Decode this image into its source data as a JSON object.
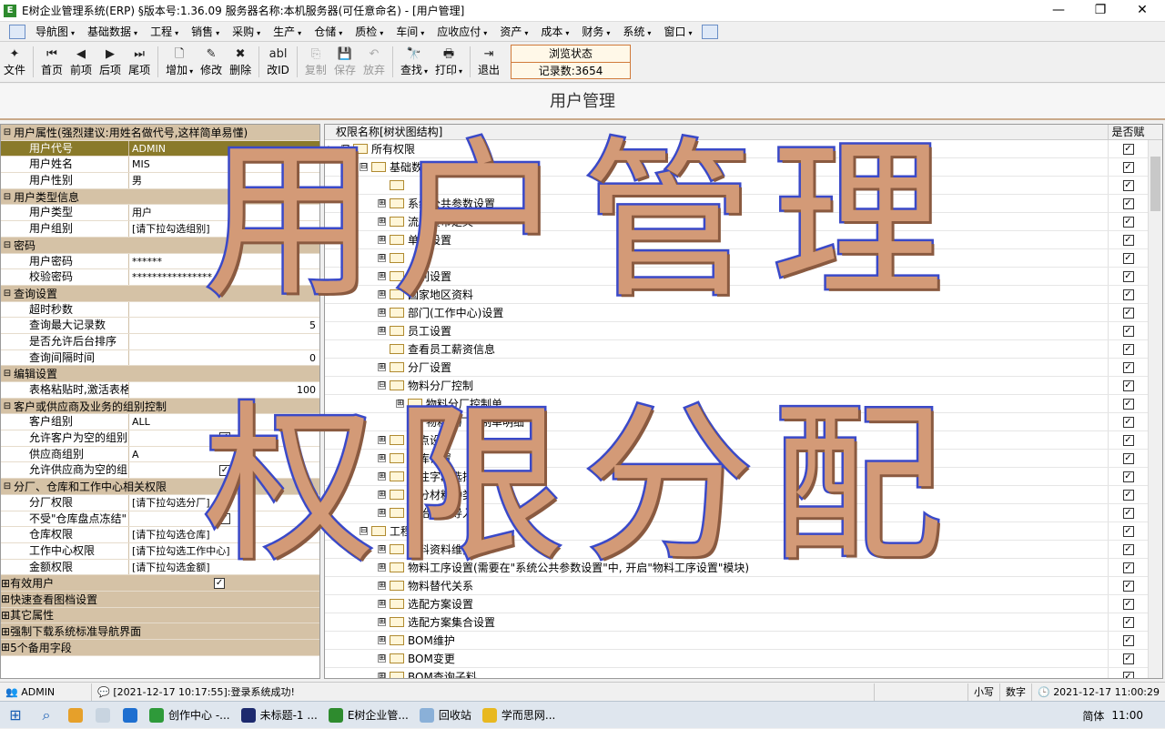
{
  "titlebar": {
    "app_icon_glyph": "E",
    "title": "E树企业管理系统(ERP) §版本号:1.36.09  服务器名称:本机服务器(可任意命名) - [用户管理]"
  },
  "menu": [
    "导航图",
    "基础数据",
    "工程",
    "销售",
    "采购",
    "生产",
    "仓储",
    "质检",
    "车间",
    "应收应付",
    "资产",
    "成本",
    "财务",
    "系统",
    "窗口"
  ],
  "toolbar": {
    "items": [
      {
        "label": "文件",
        "icon": "file-icon",
        "glyph": "✦",
        "disabled": false,
        "dropdown": false
      },
      {
        "label": "首页",
        "icon": "first-record-icon",
        "glyph": "⏮",
        "disabled": false,
        "dropdown": false
      },
      {
        "label": "前项",
        "icon": "prev-record-icon",
        "glyph": "◀",
        "disabled": false,
        "dropdown": false
      },
      {
        "label": "后项",
        "icon": "next-record-icon",
        "glyph": "▶",
        "disabled": false,
        "dropdown": false
      },
      {
        "label": "尾项",
        "icon": "last-record-icon",
        "glyph": "⏭",
        "disabled": false,
        "dropdown": false
      },
      {
        "label": "增加",
        "icon": "add-icon",
        "glyph": "🗋",
        "disabled": false,
        "dropdown": true
      },
      {
        "label": "修改",
        "icon": "edit-icon",
        "glyph": "✎",
        "disabled": false,
        "dropdown": false
      },
      {
        "label": "删除",
        "icon": "delete-icon",
        "glyph": "✖",
        "disabled": false,
        "dropdown": false
      },
      {
        "label": "改ID",
        "icon": "rename-id-icon",
        "glyph": "abl",
        "disabled": false,
        "dropdown": false
      },
      {
        "label": "复制",
        "icon": "copy-icon",
        "glyph": "⎘",
        "disabled": true,
        "dropdown": false
      },
      {
        "label": "保存",
        "icon": "save-icon",
        "glyph": "💾",
        "disabled": true,
        "dropdown": false
      },
      {
        "label": "放弃",
        "icon": "undo-icon",
        "glyph": "↶",
        "disabled": true,
        "dropdown": false
      },
      {
        "label": "查找",
        "icon": "find-icon",
        "glyph": "🔭",
        "disabled": false,
        "dropdown": true
      },
      {
        "label": "打印",
        "icon": "print-icon",
        "glyph": "🖶",
        "disabled": false,
        "dropdown": true
      },
      {
        "label": "退出",
        "icon": "exit-icon",
        "glyph": "⇥",
        "disabled": false,
        "dropdown": false
      }
    ],
    "browse_state": "浏览状态",
    "record_count": "记录数:3654"
  },
  "page_title": "用户管理",
  "properties": [
    {
      "type": "cat",
      "label": "用户属性(强烈建议:用姓名做代号,这样简单易懂)",
      "toggle": "⊟"
    },
    {
      "type": "item",
      "label": "用户代号",
      "value": "ADMIN",
      "selected": true
    },
    {
      "type": "item",
      "label": "用户姓名",
      "value": "MIS"
    },
    {
      "type": "item",
      "label": "用户性别",
      "value": "男"
    },
    {
      "type": "cat",
      "label": "用户类型信息",
      "toggle": "⊟"
    },
    {
      "type": "item",
      "label": "用户类型",
      "value": "用户"
    },
    {
      "type": "item",
      "label": "用户组别",
      "value": "[请下拉勾选组别]"
    },
    {
      "type": "cat",
      "label": "密码",
      "toggle": "⊟"
    },
    {
      "type": "item",
      "label": "用户密码",
      "value": "******"
    },
    {
      "type": "item",
      "label": "校验密码",
      "value": "****************"
    },
    {
      "type": "cat",
      "label": "查询设置",
      "toggle": "⊟"
    },
    {
      "type": "item",
      "label": "超时秒数",
      "value": ""
    },
    {
      "type": "item",
      "label": "查询最大记录数",
      "value": "5",
      "num": true
    },
    {
      "type": "item",
      "label": "是否允许后台排序",
      "value": ""
    },
    {
      "type": "item",
      "label": "查询间隔时间",
      "value": "0",
      "num": true
    },
    {
      "type": "cat",
      "label": "编辑设置",
      "toggle": "⊟"
    },
    {
      "type": "item",
      "label": "表格粘贴时,激活表格",
      "value": "100",
      "num": true
    },
    {
      "type": "cat",
      "label": "客户或供应商及业务的组别控制",
      "toggle": "⊟"
    },
    {
      "type": "item",
      "label": "客户组别",
      "value": "ALL"
    },
    {
      "type": "item",
      "label": "允许客户为空的组别",
      "value": "",
      "check": true
    },
    {
      "type": "item",
      "label": "供应商组别",
      "value": "A"
    },
    {
      "type": "item",
      "label": "允许供应商为空的组",
      "value": "",
      "check": true
    },
    {
      "type": "cat",
      "label": "分厂、仓库和工作中心相关权限",
      "toggle": "⊟"
    },
    {
      "type": "item",
      "label": "分厂权限",
      "value": "[请下拉勾选分厂]"
    },
    {
      "type": "item",
      "label": "不受\"仓库盘点冻结\"",
      "value": "",
      "check": true
    },
    {
      "type": "item",
      "label": "仓库权限",
      "value": "[请下拉勾选仓库]"
    },
    {
      "type": "item",
      "label": "工作中心权限",
      "value": "[请下拉勾选工作中心]"
    },
    {
      "type": "item",
      "label": "金额权限",
      "value": "[请下拉勾选金额]"
    },
    {
      "type": "coll",
      "label": "有效用户",
      "toggle": "⊞",
      "check": true
    },
    {
      "type": "coll",
      "label": "快速查看图档设置",
      "toggle": "⊞"
    },
    {
      "type": "coll",
      "label": "其它属性",
      "toggle": "⊞"
    },
    {
      "type": "coll",
      "label": "强制下载系统标准导航界面",
      "toggle": "⊞"
    },
    {
      "type": "coll",
      "label": "5个备用字段",
      "toggle": "⊞"
    }
  ],
  "tree": {
    "col_name": "权限名称[树状图结构]",
    "col_check": "是否赋",
    "rows": [
      {
        "level": 0,
        "exp": "⊟",
        "label": "所有权限",
        "current": true
      },
      {
        "level": 1,
        "exp": "⊟",
        "label": "基础数据"
      },
      {
        "level": 2,
        "exp": "",
        "label": ""
      },
      {
        "level": 2,
        "exp": "⊞",
        "label": "系统公共参数设置"
      },
      {
        "level": 2,
        "exp": "⊞",
        "label": "流通货币定义"
      },
      {
        "level": 2,
        "exp": "⊞",
        "label": "单位设置"
      },
      {
        "level": 2,
        "exp": "⊞",
        "label": ""
      },
      {
        "level": 2,
        "exp": "⊞",
        "label": "级别设置"
      },
      {
        "level": 2,
        "exp": "⊞",
        "label": "国家地区资料"
      },
      {
        "level": 2,
        "exp": "⊞",
        "label": "部门(工作中心)设置"
      },
      {
        "level": 2,
        "exp": "⊞",
        "label": "员工设置"
      },
      {
        "level": 2,
        "exp": "",
        "label": "查看员工薪资信息"
      },
      {
        "level": 2,
        "exp": "⊞",
        "label": "分厂设置"
      },
      {
        "level": 2,
        "exp": "⊟",
        "label": "物料分厂控制"
      },
      {
        "level": 3,
        "exp": "⊞",
        "label": "物料分厂控制单"
      },
      {
        "level": 3,
        "exp": "",
        "label": "物料分厂控制单明细"
      },
      {
        "level": 2,
        "exp": "⊞",
        "label": "地点设置"
      },
      {
        "level": 2,
        "exp": "⊞",
        "label": "仓库设置"
      },
      {
        "level": 2,
        "exp": "⊞",
        "label": "备注字段选择"
      },
      {
        "level": 2,
        "exp": "⊞",
        "label": "划分材料种类"
      },
      {
        "level": 2,
        "exp": "⊞",
        "label": "初始数据导入"
      },
      {
        "level": 1,
        "exp": "⊟",
        "label": "工程"
      },
      {
        "level": 2,
        "exp": "⊞",
        "label": "物料资料维护"
      },
      {
        "level": 2,
        "exp": "⊞",
        "label": "物料工序设置(需要在\"系统公共参数设置\"中, 开启\"物料工序设置\"模块)"
      },
      {
        "level": 2,
        "exp": "⊞",
        "label": "物料替代关系"
      },
      {
        "level": 2,
        "exp": "⊞",
        "label": "选配方案设置"
      },
      {
        "level": 2,
        "exp": "⊞",
        "label": "选配方案集合设置"
      },
      {
        "level": 2,
        "exp": "⊞",
        "label": "BOM维护"
      },
      {
        "level": 2,
        "exp": "⊞",
        "label": "BOM变更"
      },
      {
        "level": 2,
        "exp": "⊞",
        "label": "BOM查询子料"
      }
    ]
  },
  "statusbar": {
    "user": "ADMIN",
    "message": "[2021-12-17 10:17:55]:登录系统成功!",
    "caps": "小写",
    "numlock": "数字",
    "datetime": "2021-12-17  11:00:29"
  },
  "overlay": {
    "line1": "用户管理",
    "line2": "权限分配"
  },
  "taskbar": {
    "apps": [
      {
        "label": "",
        "color": "#e6a02a"
      },
      {
        "label": "",
        "color": "#c8d4e0"
      },
      {
        "label": "",
        "color": "#1e6fd0"
      },
      {
        "label": "创作中心 -...",
        "color": "#2e9a3a"
      },
      {
        "label": "未标题-1 ...",
        "color": "#1d2a6e"
      },
      {
        "label": "E树企业管...",
        "color": "#2e8b2e"
      },
      {
        "label": "回收站",
        "color": "#8ab0d8"
      },
      {
        "label": "学而思网...",
        "color": "#e8b820"
      }
    ],
    "ime": "简体",
    "clock": "11:00"
  },
  "colors": {
    "category_bg": "#d5c2a6",
    "selected_bg": "#8a7a2a",
    "overlay_fill": "#d39a77",
    "overlay_stroke": "#3a49c8"
  }
}
